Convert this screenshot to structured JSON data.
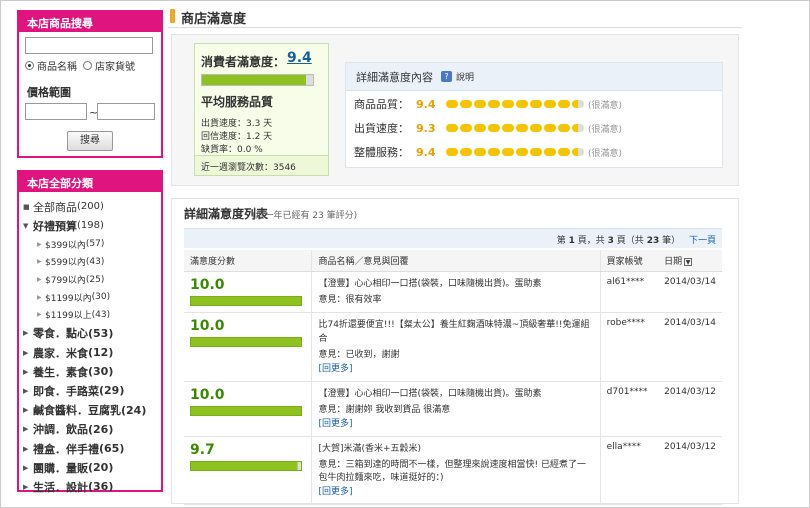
{
  "search": {
    "title": "本店商品搜尋",
    "keyword_value": "",
    "radio_name": "商品名稱",
    "radio_code": "店家貨號",
    "price_label": "價格範圍",
    "tilde": "~",
    "button": "搜尋"
  },
  "categories": {
    "title": "本店全部分類",
    "items": [
      {
        "label": "全部商品",
        "count": "(200)"
      },
      {
        "label": "好禮預算",
        "count": "(198)"
      },
      {
        "label": "$399以內",
        "count": "(57)"
      },
      {
        "label": "$599以內",
        "count": "(43)"
      },
      {
        "label": "$799以內",
        "count": "(25)"
      },
      {
        "label": "$1199以內",
        "count": "(30)"
      },
      {
        "label": "$1199以上",
        "count": "(43)"
      },
      {
        "label": "零食．點心",
        "count": "(53)"
      },
      {
        "label": "農家．米食",
        "count": "(12)"
      },
      {
        "label": "養生．素食",
        "count": "(30)"
      },
      {
        "label": "即食．手路菜",
        "count": "(29)"
      },
      {
        "label": "鹹食醬料．豆腐乳",
        "count": "(24)"
      },
      {
        "label": "沖調．飲品",
        "count": "(26)"
      },
      {
        "label": "禮盒．伴手禮",
        "count": "(65)"
      },
      {
        "label": "團購．量販",
        "count": "(20)"
      },
      {
        "label": "生活．設計",
        "count": "(36)"
      }
    ]
  },
  "page_title": "商店滿意度",
  "consumer": {
    "label": "消費者滿意度：",
    "score": "9.4",
    "score_fraction": 0.94,
    "service_title": "平均服務品質",
    "ship_speed": "出貨速度：3.3 天",
    "reply_speed": "回信速度：1.2 天",
    "stockout": "缺貨率：0.0 %",
    "visits": "近一週瀏覽次數：3546"
  },
  "detail": {
    "title": "詳細滿意度內容",
    "help": "?",
    "help_label": "說明",
    "rows": [
      {
        "key": "商品品質：",
        "value": "9.4",
        "rating": "(很滿意)"
      },
      {
        "key": "出貨速度：",
        "value": "9.3",
        "rating": "(很滿意)"
      },
      {
        "key": "整體服務：",
        "value": "9.4",
        "rating": "(很滿意)"
      }
    ]
  },
  "list": {
    "title": "詳細滿意度列表",
    "subtitle": "(近一年已經有 23 筆評分)",
    "pager_prefix": "第",
    "pager_page": "1",
    "pager_mid": "頁，共",
    "pager_total_pages": "3",
    "pager_mid2": "頁（共",
    "pager_total_items": "23",
    "pager_suffix": "筆）",
    "next": "下一頁",
    "headers": {
      "score": "滿意度分數",
      "content": "商品名稱／意見與回覆",
      "account": "買家帳號",
      "date": "日期"
    },
    "reviews": [
      {
        "score": "10.0",
        "score_fraction": 1.0,
        "product": "【澄豐】心心相印一口搭(袋裝，口味隨機出貨)。蛋助素",
        "opinion": "意見：很有效率",
        "more": "",
        "account": "al61****",
        "date": "2014/03/14"
      },
      {
        "score": "10.0",
        "score_fraction": 1.0,
        "product": "比74折還要便宜!!!【粲太公】養生紅麴酒味特濃~頂級奢華!!免運組合",
        "opinion": "意見：已收到，謝謝",
        "more": "[回更多]",
        "account": "robe****",
        "date": "2014/03/14"
      },
      {
        "score": "10.0",
        "score_fraction": 1.0,
        "product": "【澄豐】心心相印一口搭(袋裝，口味隨機出貨)。蛋助素",
        "opinion": "意見：謝謝妳 我收到貨品 很滿意",
        "more": "[回更多]",
        "account": "d701****",
        "date": "2014/03/12"
      },
      {
        "score": "9.7",
        "score_fraction": 0.97,
        "product": "[大賀]米滿(香米+五穀米)",
        "opinion": "意見：三箱到達的時間不一樣，但整理來說速度相當快! 已經煮了一包牛肉拉麵來吃，味道挺好的：)",
        "more": "[回更多]",
        "account": "ella****",
        "date": "2014/03/12"
      }
    ]
  }
}
